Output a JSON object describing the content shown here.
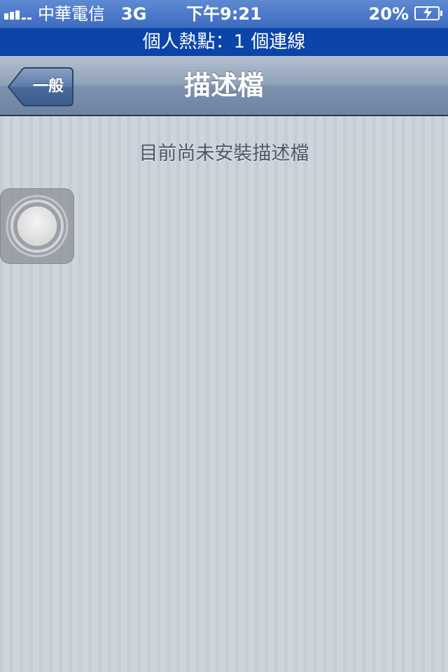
{
  "status_bar": {
    "carrier": "中華電信",
    "network": "3G",
    "time": "下午9:21",
    "battery_percent": "20%",
    "icons": {
      "signal": "signal-strength-icon",
      "battery": "battery-charging-icon"
    }
  },
  "hotspot_banner": {
    "text": "個人熱點：1 個連線"
  },
  "nav_bar": {
    "back_label": "一般",
    "title": "描述檔"
  },
  "content": {
    "empty_message": "目前尚未安裝描述檔"
  },
  "assistive_touch": {
    "icon": "assistive-touch-icon"
  }
}
